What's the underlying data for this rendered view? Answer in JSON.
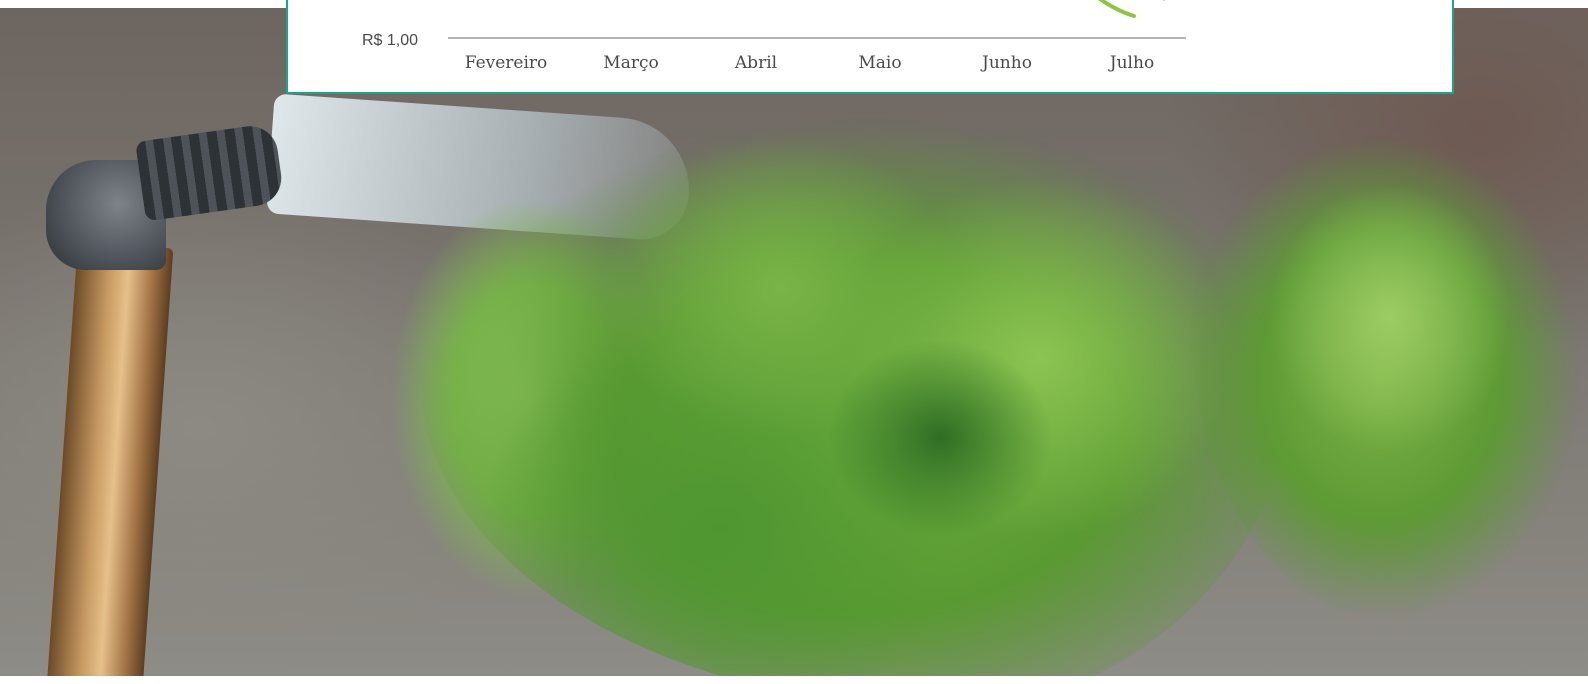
{
  "chart_data": {
    "type": "line",
    "x_ticks": [
      "Fevereiro",
      "Março",
      "Abril",
      "Maio",
      "Junho",
      "Julho"
    ],
    "y_ticks": [
      "R$ 1,00"
    ],
    "line_color": "#8dc63f",
    "axis_color": "#9a9a9a",
    "grid": false
  },
  "card": {
    "border_color": "#1aa58a"
  },
  "photo": {
    "subject": "lettuce-being-washed-under-water-pipe"
  }
}
